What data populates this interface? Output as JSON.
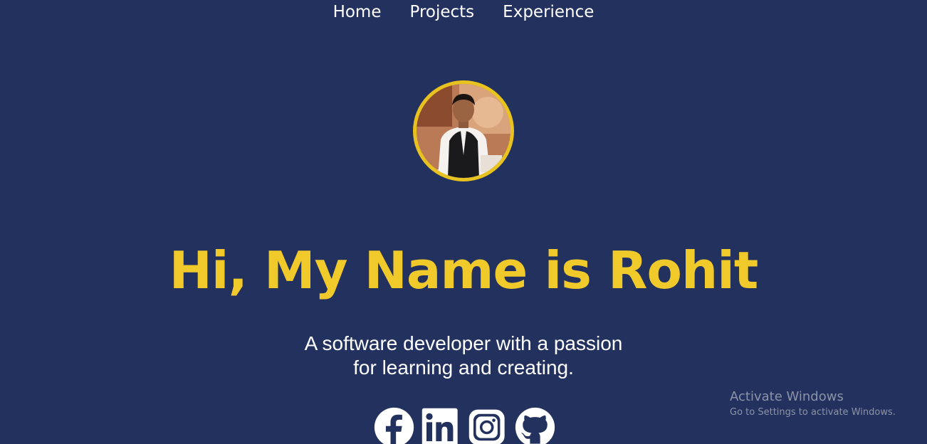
{
  "nav": {
    "items": [
      {
        "label": "Home"
      },
      {
        "label": "Projects"
      },
      {
        "label": "Experience"
      }
    ]
  },
  "hero": {
    "headline": "Hi, My Name is Rohit",
    "tagline_line1": "A software developer with a passion",
    "tagline_line2": "for learning and creating."
  },
  "socials": [
    {
      "name": "facebook",
      "icon": "facebook-icon"
    },
    {
      "name": "linkedin",
      "icon": "linkedin-icon"
    },
    {
      "name": "instagram",
      "icon": "instagram-icon"
    },
    {
      "name": "github",
      "icon": "github-icon"
    }
  ],
  "watermark": {
    "title": "Activate Windows",
    "subtitle": "Go to Settings to activate Windows."
  },
  "colors": {
    "background": "#23315e",
    "accent": "#f0c92a",
    "text": "#ffffff"
  }
}
